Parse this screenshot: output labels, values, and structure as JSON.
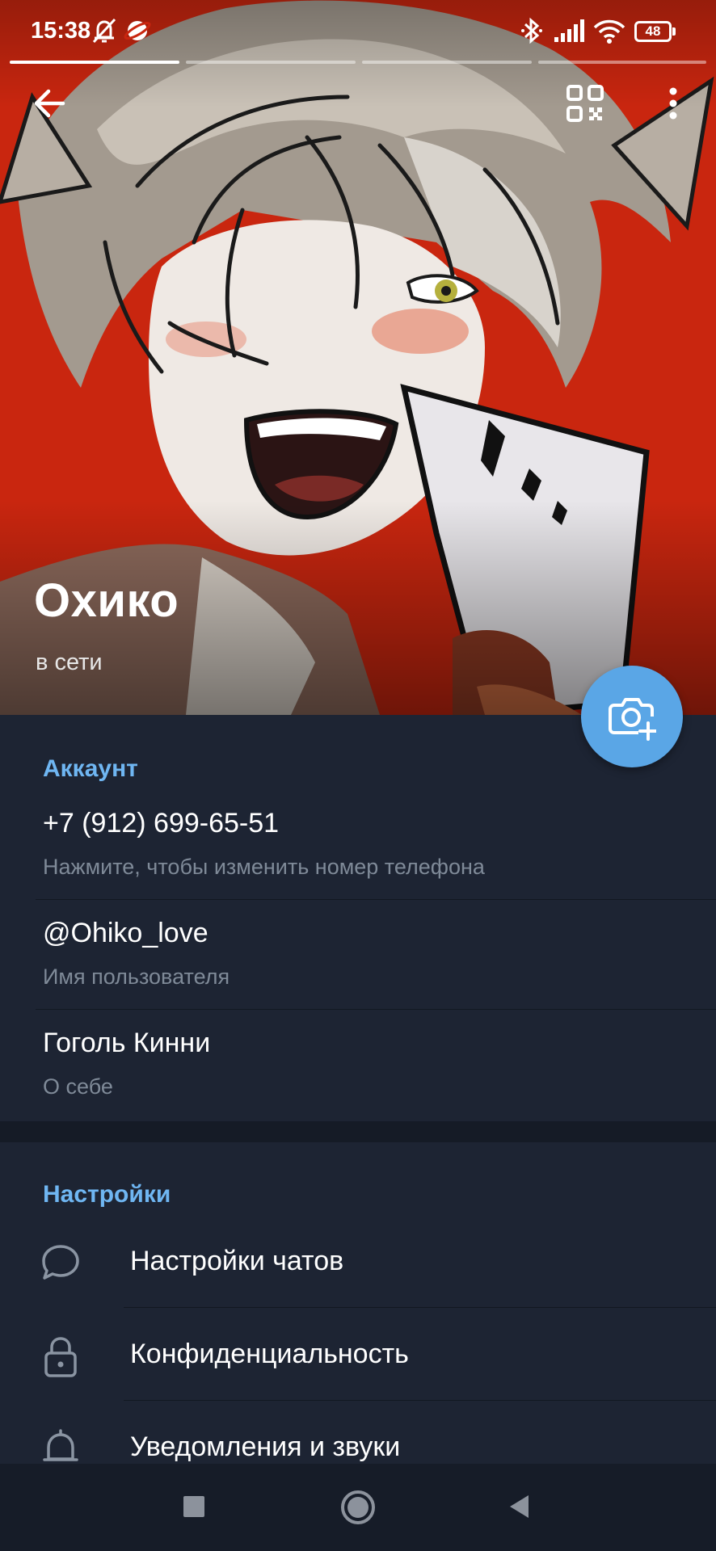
{
  "status_bar": {
    "time": "15:38",
    "battery": "48",
    "icons": [
      "mute-bell-icon",
      "planet-icon",
      "bluetooth-icon",
      "signal-icon",
      "wifi-icon",
      "battery-icon"
    ]
  },
  "header": {
    "back_icon": "arrow-left-icon",
    "qr_icon": "qr-code-icon",
    "menu_icon": "more-vertical-icon"
  },
  "profile": {
    "name": "Охико",
    "status": "в сети",
    "set_photo_icon": "camera-add-icon"
  },
  "account": {
    "title": "Аккаунт",
    "phone": "+7 (912) 699-65-51",
    "phone_hint": "Нажмите, чтобы изменить номер телефона",
    "username": "@Ohiko_love",
    "username_hint": "Имя пользователя",
    "bio": "Гоголь Кинни",
    "bio_hint": "О себе"
  },
  "settings": {
    "title": "Настройки",
    "items": [
      {
        "label": "Настройки чатов",
        "icon": "chat-bubble-icon"
      },
      {
        "label": "Конфиденциальность",
        "icon": "lock-icon"
      },
      {
        "label": "Уведомления и звуки",
        "icon": "bell-icon"
      }
    ]
  },
  "nav_bar": {
    "icons": [
      "recents-square-icon",
      "home-circle-icon",
      "back-triangle-icon"
    ]
  },
  "colors": {
    "accent": "#6fb6f2",
    "fab": "#5aa6e6",
    "background": "#1d2433",
    "hero_background": "#c8260f"
  }
}
